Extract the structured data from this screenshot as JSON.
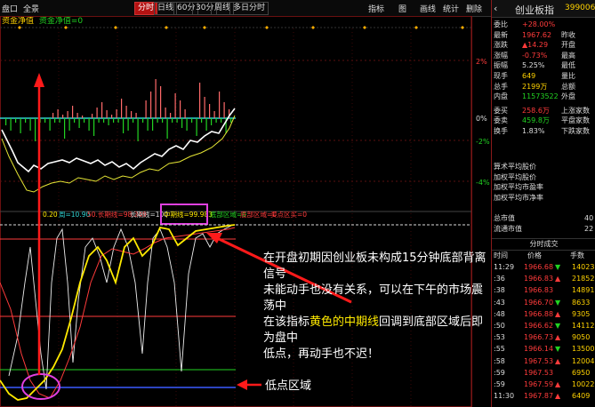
{
  "toolbar": {
    "left_items": [
      "盘口",
      "全景"
    ],
    "period_buttons": [
      "分时",
      "日线",
      "60分",
      "30分",
      "周线",
      "多日分时"
    ],
    "active_period": "分时",
    "right_items": [
      "指标",
      "图",
      "画线",
      "统计",
      "删除"
    ]
  },
  "legend_top": {
    "name": "资金净值",
    "value": "资金净值=0"
  },
  "price_axis": {
    "labels": [
      "2%",
      "0%",
      "-2%",
      "-4%"
    ]
  },
  "indicator_legend": {
    "items": [
      "0.20",
      "周=10.90",
      "50.长期线=98.249",
      "长期线=100",
      "中期线=99.983",
      "底部区域=0",
      "底部区域=0",
      "买点区买=0"
    ],
    "highlight_box": "中期线=99.983"
  },
  "annotation": {
    "line1": "在开盘初期因创业板未构成15分钟底部背离信号",
    "line2": "未能动手也没有关系，可以在下午的市场震荡中",
    "line3_pre": "在该指标",
    "line3_hl": "黄色的中期线",
    "line3_post": "回调到底部区域后即为盘中",
    "line4": "低点，再动手也不迟！",
    "low_zone": "低点区域"
  },
  "quote_panel": {
    "title": "创业板指",
    "code": "399006",
    "stats": [
      {
        "l": "委比",
        "v": "+28.00%",
        "l2": "",
        "v2": "",
        "c": "red"
      },
      {
        "l": "最新",
        "v": "1967.62",
        "l2": "昨收",
        "v2": "",
        "c": "red"
      },
      {
        "l": "涨跌",
        "v": "▲14.29",
        "l2": "开盘",
        "v2": "",
        "c": "red"
      },
      {
        "l": "涨幅",
        "v": "-0.73%",
        "l2": "最高",
        "v2": "",
        "c": "red"
      },
      {
        "l": "振幅",
        "v": "5.25%",
        "l2": "最低",
        "v2": "",
        "c": "wht"
      },
      {
        "l": "现手",
        "v": "649",
        "l2": "量比",
        "v2": "",
        "c": "yel"
      },
      {
        "l": "总手",
        "v": "2199万",
        "l2": "总额",
        "v2": "",
        "c": "yel"
      },
      {
        "l": "内盘",
        "v": "11573522",
        "l2": "外盘",
        "v2": "",
        "c": "grn"
      },
      {
        "l": "委买",
        "v": "258.6万",
        "l2": "上涨家数",
        "v2": "",
        "c": "red"
      },
      {
        "l": "委卖",
        "v": "459.8万",
        "l2": "平盘家数",
        "v2": "",
        "c": "grn"
      },
      {
        "l": "换手",
        "v": "1.83%",
        "l2": "下跌家数",
        "v2": "",
        "c": "wht"
      }
    ],
    "avg_items": [
      "算术平均股价",
      "加权平均股价",
      "加权平均市盈率",
      "加权平均市净率"
    ],
    "cap": [
      {
        "l": "总市值",
        "v": "40"
      },
      {
        "l": "流通市值",
        "v": "22"
      }
    ],
    "tick_title": "分时成交",
    "tick_headers": [
      "时间",
      "价格",
      "手数"
    ],
    "ticks": [
      {
        "t": "11:29",
        "p": "1966.68",
        "d": "▼",
        "v": "14023"
      },
      {
        "t": ":36",
        "p": "1966.83",
        "d": "▲",
        "v": "21852"
      },
      {
        "t": ":38",
        "p": "1966.83",
        "d": "",
        "v": "14891"
      },
      {
        "t": ":43",
        "p": "1966.70",
        "d": "▼",
        "v": "8633"
      },
      {
        "t": ":48",
        "p": "1966.88",
        "d": "▲",
        "v": "9305"
      },
      {
        "t": ":50",
        "p": "1966.62",
        "d": "▼",
        "v": "14112"
      },
      {
        "t": ":53",
        "p": "1966.73",
        "d": "▲",
        "v": "9050"
      },
      {
        "t": ":55",
        "p": "1966.14",
        "d": "▼",
        "v": "13500"
      },
      {
        "t": ":58",
        "p": "1967.53",
        "d": "▲",
        "v": "12004"
      },
      {
        "t": ":59",
        "p": "1967.53",
        "d": "",
        "v": "6950"
      },
      {
        "t": ":59",
        "p": "1967.59",
        "d": "▲",
        "v": "10022"
      },
      {
        "t": "11:30",
        "p": "1967.87",
        "d": "▲",
        "v": "6409"
      }
    ]
  },
  "colors": {
    "up": "#ff3b3b",
    "down": "#22d322",
    "medium_line": "#ffea00",
    "highlight": "#e040e0",
    "arrow": "#ff1a1a"
  }
}
